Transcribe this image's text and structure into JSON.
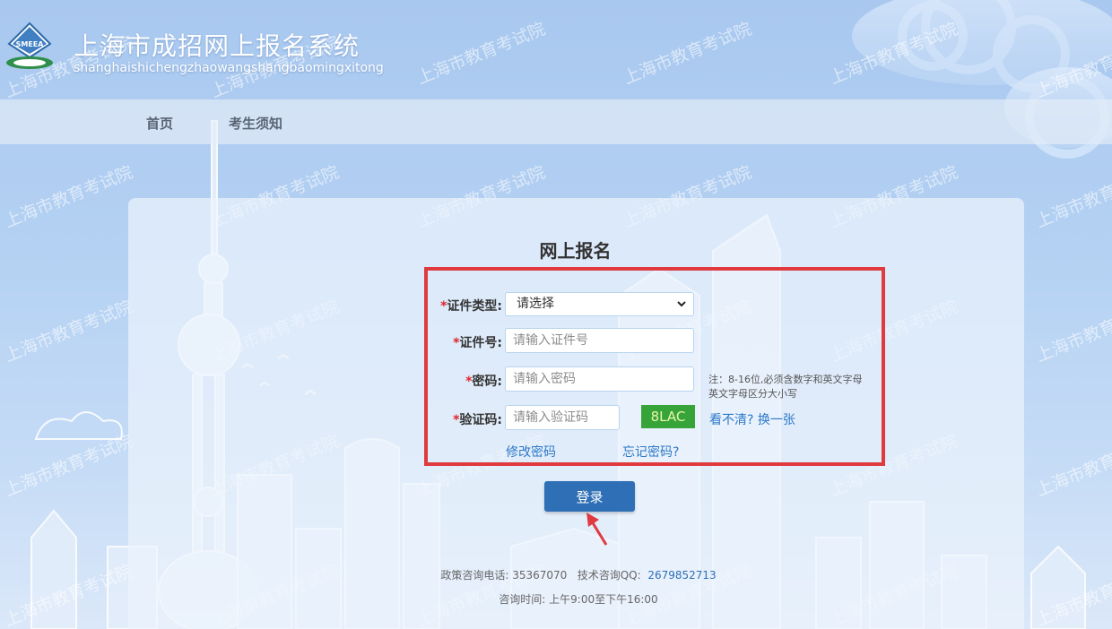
{
  "header": {
    "title": "上海市成招网上报名系统",
    "subtitle": "shanghaishichengzhaowangshangbaomingxitong",
    "logo_text": "SMEEA"
  },
  "nav": {
    "home": "首页",
    "notice": "考生须知"
  },
  "watermark_text": "上海市教育考试院",
  "form": {
    "title": "网上报名",
    "required_mark": "*",
    "id_type": {
      "label": "证件类型:",
      "selected": "请选择"
    },
    "id_number": {
      "label": "证件号:",
      "placeholder": "请输入证件号"
    },
    "password": {
      "label": "密码:",
      "placeholder": "请输入密码",
      "hint_line1": "注：8-16位,必须含数字和英文字母",
      "hint_line2": "英文字母区分大小写"
    },
    "captcha": {
      "label": "验证码:",
      "placeholder": "请输入验证码",
      "code": "8LAC",
      "refresh_link": "看不清? 换一张"
    },
    "change_password_link": "修改密码",
    "forgot_password_link": "忘记密码?",
    "login_button": "登录"
  },
  "footer": {
    "policy_label": "政策咨询电话:",
    "policy_phone": "35367070",
    "tech_label": "技术咨询QQ:",
    "tech_qq": "2679852713",
    "hours": "咨询时间: 上午9:00至下午16:00"
  },
  "colors": {
    "highlight_box": "#e03a3f",
    "login_button": "#2e6fb6",
    "captcha_bg": "#37a43a",
    "link": "#2c79c8"
  }
}
